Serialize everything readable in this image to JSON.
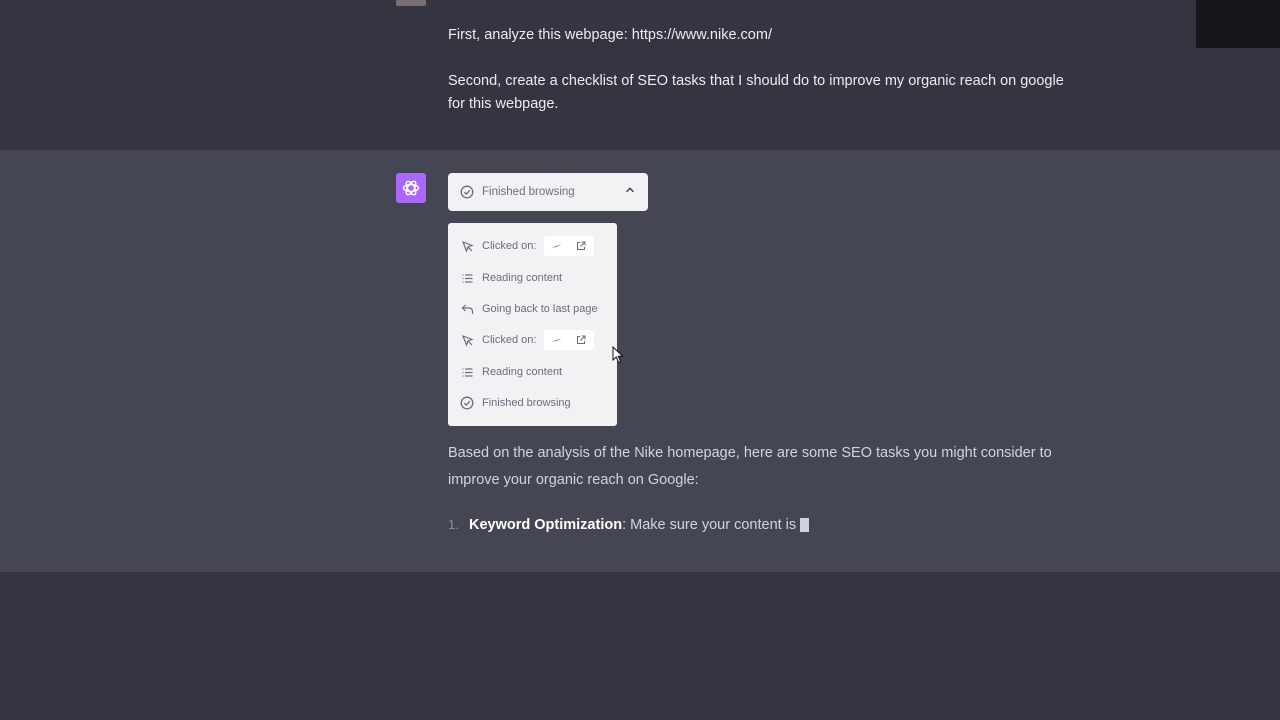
{
  "user_message": {
    "line1": "First, analyze this webpage: https://www.nike.com/",
    "line2": "Second, create a checklist of SEO tasks that I should do to improve my organic reach on google for this webpage."
  },
  "browsing": {
    "header_label": "Finished browsing",
    "steps": [
      {
        "icon": "cursor-icon",
        "label": "Clicked on:"
      },
      {
        "icon": "list-icon",
        "label": "Reading content"
      },
      {
        "icon": "back-arrow-icon",
        "label": "Going back to last page"
      },
      {
        "icon": "cursor-icon",
        "label": "Clicked on:"
      },
      {
        "icon": "list-icon",
        "label": "Reading content"
      },
      {
        "icon": "check-circle-icon",
        "label": "Finished browsing"
      }
    ]
  },
  "answer": {
    "intro": "Based on the analysis of the Nike homepage, here are some SEO tasks you might consider to improve your organic reach on Google:",
    "item1_number": "1.",
    "item1_title": "Keyword Optimization",
    "item1_text": ": Make sure your content is"
  },
  "colors": {
    "background": "#343541",
    "assistant_background": "#444654",
    "avatar_purple": "#ab68ff",
    "panel_background": "#f2f2f5"
  }
}
